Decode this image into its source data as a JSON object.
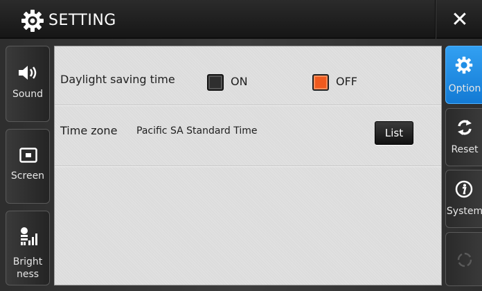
{
  "titlebar": {
    "title": "SETTING",
    "close_label": "✕"
  },
  "left_tabs": [
    {
      "label": "Sound",
      "icon": "speaker-icon"
    },
    {
      "label": "Screen",
      "icon": "screen-icon"
    },
    {
      "label_line1": "Bright",
      "label_line2": "ness",
      "icon": "brightness-icon"
    }
  ],
  "right_tabs": [
    {
      "label": "Option",
      "icon": "gear-icon",
      "active": true
    },
    {
      "label": "Reset",
      "icon": "reset-icon"
    },
    {
      "label": "System",
      "icon": "info-icon"
    },
    {
      "label": "",
      "icon": "loading-icon"
    }
  ],
  "options": {
    "dst": {
      "label": "Daylight  saving time",
      "on_label": "ON",
      "off_label": "OFF",
      "selected": "OFF"
    },
    "timezone": {
      "label": "Time zone",
      "value": "Pacific SA Standard Time",
      "list_label": "List"
    }
  },
  "colors": {
    "accent": "#1f8ee6",
    "off_selected": "#f05a1e",
    "panel": "#dcdcdc"
  }
}
